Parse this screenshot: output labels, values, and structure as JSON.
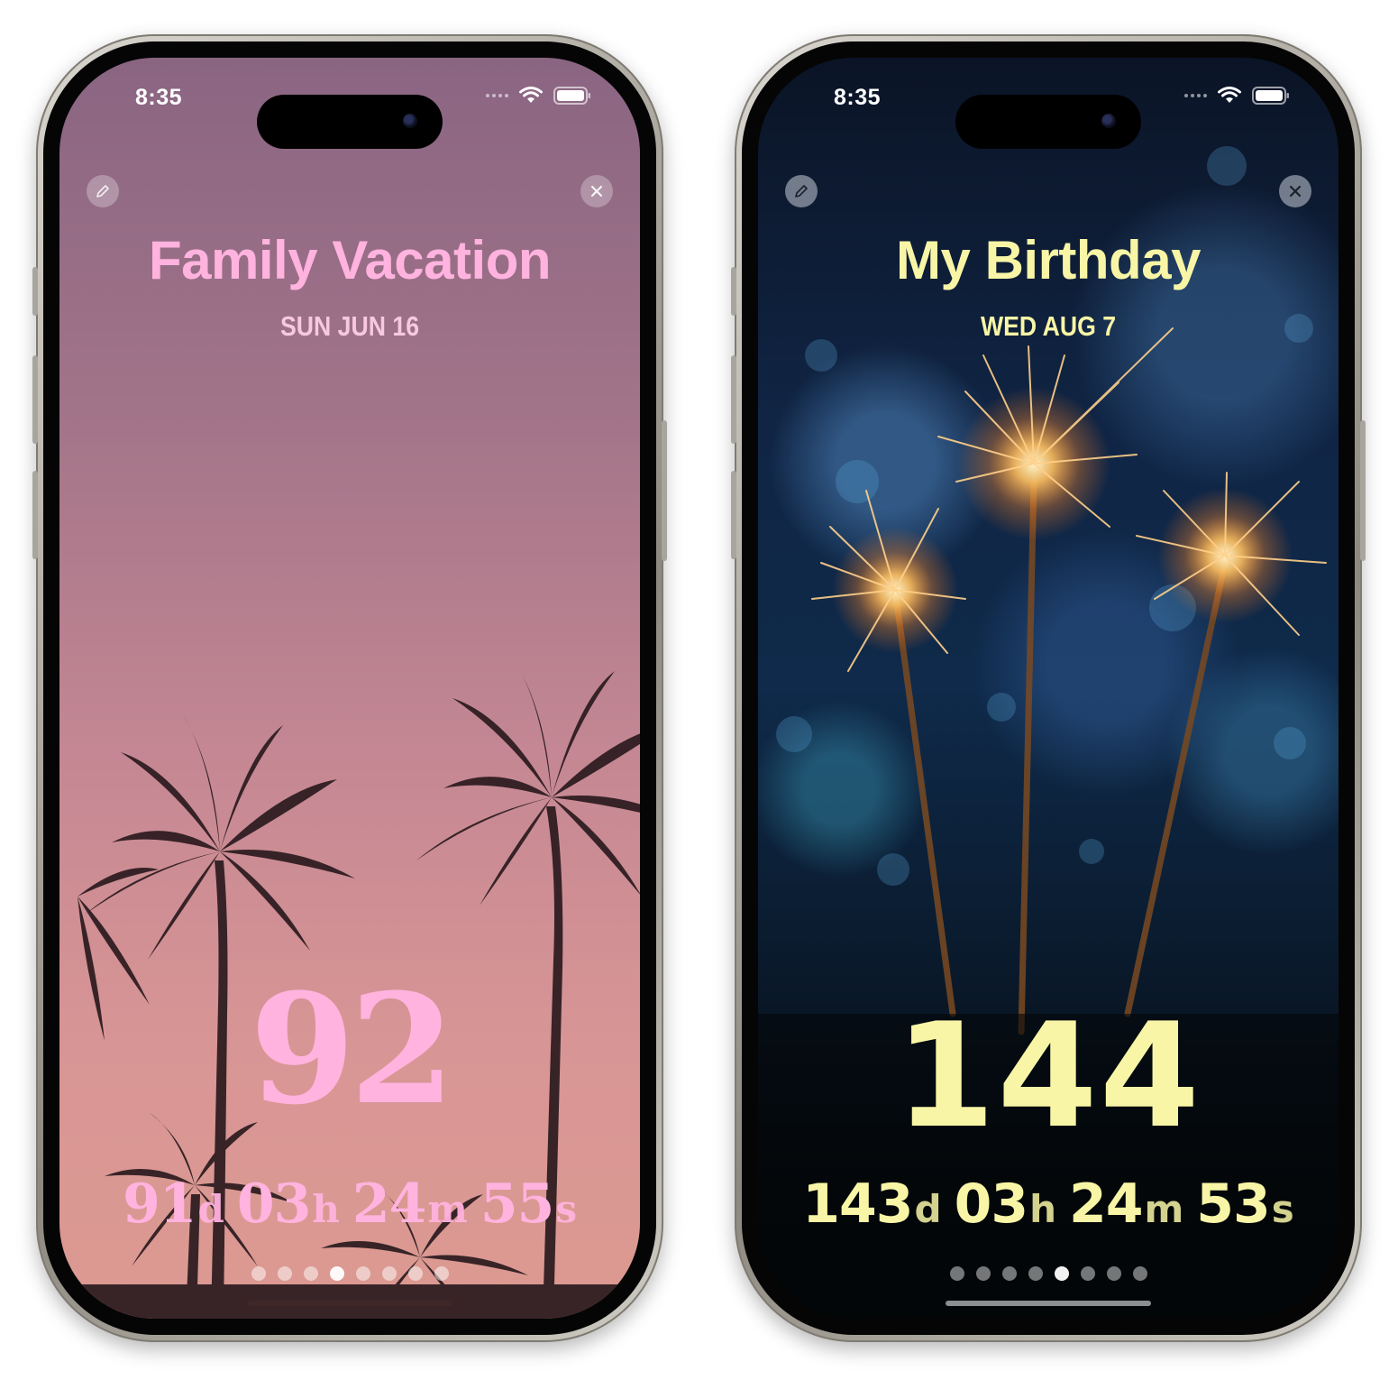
{
  "colors": {
    "pink_accent": "#ffb3de",
    "yellow_accent": "#f8f6a6",
    "status_text": "#ffffff"
  },
  "phones": [
    {
      "status_time": "8:35",
      "icons": [
        "signal-dots-icon",
        "wifi-icon",
        "battery-icon"
      ],
      "edit_icon": "pencil-icon",
      "close_icon": "close-icon",
      "title": "Family Vacation",
      "date": "SUN JUN 16",
      "big_number": "92",
      "countdown": [
        {
          "num": "91",
          "unit": "d"
        },
        {
          "num": "03",
          "unit": "h"
        },
        {
          "num": "24",
          "unit": "m"
        },
        {
          "num": "55",
          "unit": "s"
        }
      ],
      "page_count": 8,
      "active_page": 4
    },
    {
      "status_time": "8:35",
      "icons": [
        "signal-dots-icon",
        "wifi-icon",
        "battery-icon"
      ],
      "edit_icon": "pencil-icon",
      "close_icon": "close-icon",
      "title": "My Birthday",
      "date": "WED AUG 7",
      "big_number": "144",
      "countdown": [
        {
          "num": "143",
          "unit": "d"
        },
        {
          "num": "03",
          "unit": "h"
        },
        {
          "num": "24",
          "unit": "m"
        },
        {
          "num": "53",
          "unit": "s"
        }
      ],
      "page_count": 8,
      "active_page": 5
    }
  ]
}
